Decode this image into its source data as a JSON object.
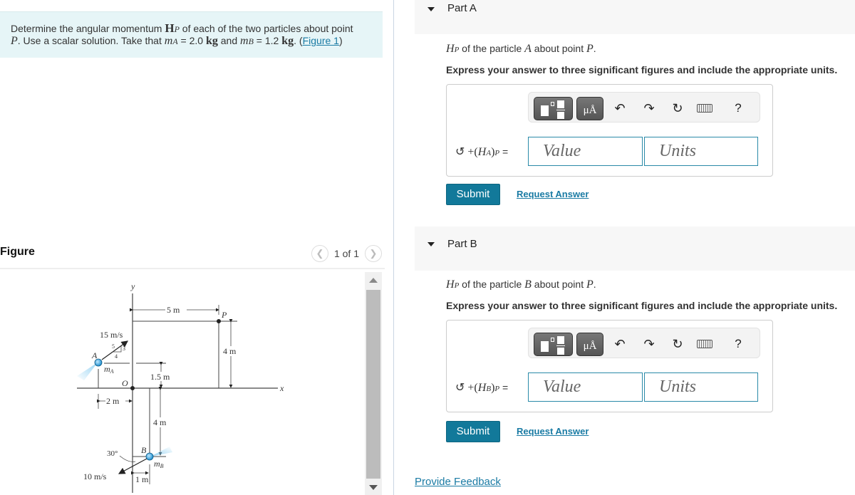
{
  "problem": {
    "text_1": "Determine the angular momentum ",
    "H": "H",
    "H_sub": "P",
    "text_2": " of each of the two particles about point",
    "P": "P",
    "text_3": ". Use a scalar solution. Take that ",
    "mA": "m",
    "mA_sub": "A",
    "mA_val": " = 2.0 ",
    "kg1": "kg",
    "text_4": " and ",
    "mB": "m",
    "mB_sub": "B",
    "mB_val": " = 1.2 ",
    "kg2": "kg",
    "text_5": ". (",
    "figure_link": "Figure 1",
    "text_6": ")"
  },
  "figure": {
    "title": "Figure",
    "pager": "1 of 1",
    "prev_icon": "chevron-left-icon",
    "next_icon": "chevron-right-icon",
    "labels": {
      "y_axis": "y",
      "x_axis": "x",
      "dim_5m": "5 m",
      "P": "P",
      "dim_4m_right": "4 m",
      "vA": "15 m/s",
      "tri_5": "5",
      "tri_3": "3",
      "tri_4": "4",
      "A": "A",
      "mA": "m",
      "mA_sub": "A",
      "O": "O",
      "dim_1_5m": "1.5 m",
      "dim_2m": "2 m",
      "dim_4m_lower": "4 m",
      "angle": "30°",
      "B": "B",
      "mB": "m",
      "mB_sub": "B",
      "vB": "10 m/s",
      "dim_1m": "1 m"
    }
  },
  "parts": [
    {
      "title": "Part A",
      "q_H": "H",
      "q_sub": "P",
      "q_text1": " of the particle ",
      "q_particle": "A",
      "q_text2": " about point ",
      "q_point": "P",
      "q_end": ".",
      "instruction": "Express your answer to three significant figures and include the appropriate units.",
      "eq_prefix": "↺ +(",
      "eq_H": "H",
      "eq_sub": "A",
      "eq_close": ")",
      "eq_P": "P",
      "eq_equals": " =",
      "value_placeholder": "Value",
      "units_placeholder": "Units",
      "toolbar": {
        "units_label": "μÅ",
        "undo": "↶",
        "redo": "↷",
        "reset": "↻",
        "help": "?"
      },
      "submit": "Submit",
      "request": "Request Answer"
    },
    {
      "title": "Part B",
      "q_H": "H",
      "q_sub": "P",
      "q_text1": " of the particle ",
      "q_particle": "B",
      "q_text2": " about point ",
      "q_point": "P",
      "q_end": ".",
      "instruction": "Express your answer to three significant figures and include the appropriate units.",
      "eq_prefix": "↺ +(",
      "eq_H": "H",
      "eq_sub": "B",
      "eq_close": ")",
      "eq_P": "P",
      "eq_equals": " =",
      "value_placeholder": "Value",
      "units_placeholder": "Units",
      "toolbar": {
        "units_label": "μÅ",
        "undo": "↶",
        "redo": "↷",
        "reset": "↻",
        "help": "?"
      },
      "submit": "Submit",
      "request": "Request Answer"
    }
  ],
  "footer": {
    "feedback": "Provide Feedback"
  },
  "colors": {
    "accent": "#12799a",
    "link": "#1a7ba4",
    "problem_bg": "#e6f5f7",
    "part_header_bg": "#f7f7f7"
  }
}
